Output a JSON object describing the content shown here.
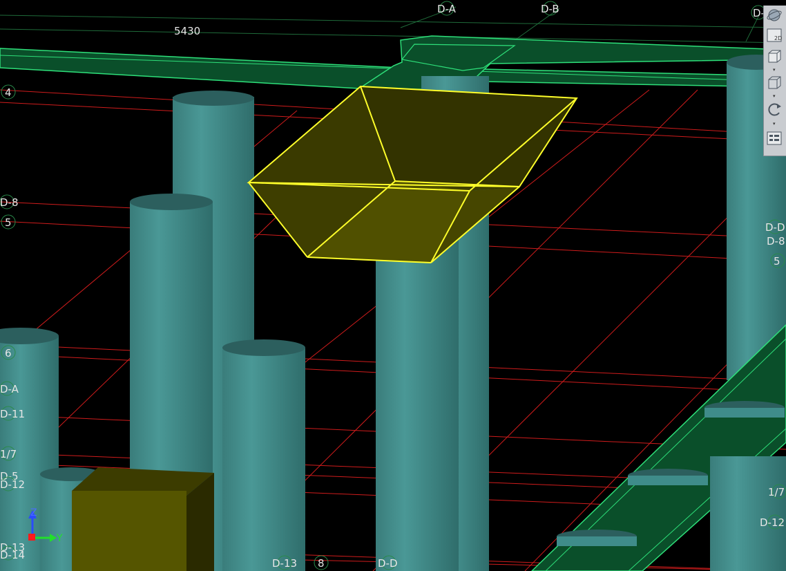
{
  "view": {
    "dimension_label": "5430",
    "grid_labels_top": [
      "D-A",
      "D-B",
      "D-"
    ],
    "grid_labels_left": [
      "4",
      "D-8",
      "5",
      "6",
      "D-A",
      "D-11",
      "1/7",
      "D-5",
      "D-12",
      "D-13",
      "D-14"
    ],
    "grid_labels_right": [
      "D-D",
      "D-8",
      "5",
      "1/7",
      "D-12"
    ],
    "grid_labels_bottom": [
      "D-13",
      "8",
      "D-D"
    ]
  },
  "toolbar": {
    "view_2d_label": "2D",
    "buttons": [
      "orbit-icon",
      "view-2d-icon",
      "view-3d-box-icon",
      "view-box-icon",
      "rotate-icon",
      "properties-icon"
    ]
  },
  "axis": {
    "z_label": "Z",
    "y_label": "Y"
  },
  "colors": {
    "background": "#000000",
    "gridline": "#d01c1c",
    "beam_fill": "#0a4f2a",
    "beam_edge": "#2ee07a",
    "column": "#3f8c8a",
    "selection": "#ffff2a",
    "hopper": "#4a4a00"
  }
}
